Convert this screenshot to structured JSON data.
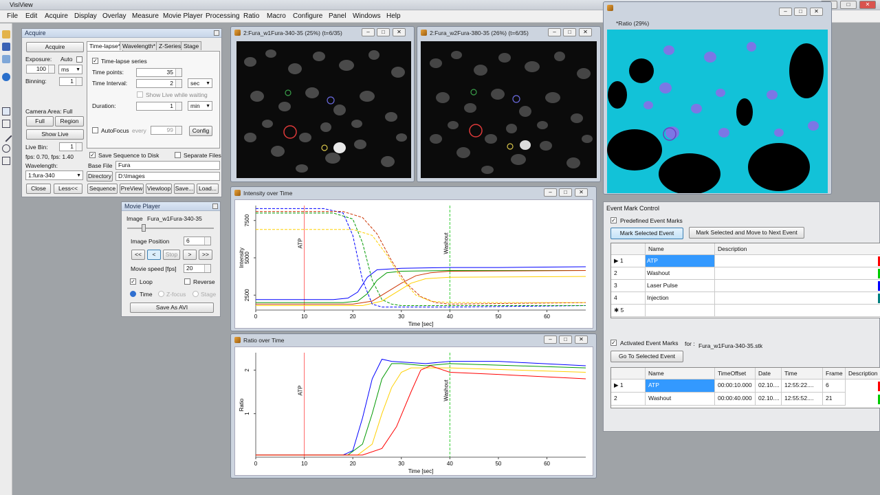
{
  "app": {
    "title": "VisiView"
  },
  "menu": [
    "File",
    "Edit",
    "Acquire",
    "Display",
    "Overlay",
    "Measure",
    "Movie Player",
    "Processing",
    "Ratio",
    "Macro",
    "Configure",
    "Panel",
    "Windows",
    "Help"
  ],
  "acquire": {
    "title": "Acquire",
    "acquire_btn": "Acquire",
    "exposure_label": "Exposure:",
    "auto_label": "Auto",
    "exposure_value": "100",
    "exposure_unit": "ms",
    "binning_label": "Binning:",
    "binning_value": "1",
    "camera_area_label": "Camera Area: Full",
    "full_btn": "Full",
    "region_btn": "Region",
    "show_live_btn": "Show Live",
    "live_bin_label": "Live Bin:",
    "live_bin_value": "1",
    "fps_text": "fps: 0.70, fps: 1.40",
    "wavelength_label": "Wavelength:",
    "wavelength_value": "1:fura-340",
    "close_btn": "Close",
    "less_btn": "Less<<",
    "tabs": [
      "Time-lapse*",
      "Wavelength*",
      "Z-Series",
      "Stage"
    ],
    "timelapse_series": "Time-lapse series",
    "time_points_label": "Time points:",
    "time_points_value": "35",
    "time_interval_label": "Time Interval:",
    "time_interval_value": "2",
    "time_interval_unit": "sec",
    "show_live_waiting": "Show Live while waiting",
    "duration_label": "Duration:",
    "duration_value": "1",
    "duration_unit": "min",
    "autofocus_label": "AutoFocus",
    "every_label": "every",
    "every_value": "99",
    "config_btn": "Config",
    "save_seq_label": "Save Sequence to Disk",
    "separate_files_label": "Separate Files",
    "base_file_label": "Base File",
    "base_file_value": "Fura",
    "directory_btn": "Directory",
    "directory_value": "D:\\Images",
    "bottom_buttons": [
      "Sequence",
      "PreView",
      "Viewloop",
      "Save...",
      "Load..."
    ]
  },
  "movie": {
    "title": "Movie Player",
    "image_label": "Image",
    "image_name": "Fura_w1Fura-340-35",
    "image_position_label": "Image Position",
    "image_position_value": "6",
    "nav": [
      "<<",
      "<",
      "Stop",
      ">",
      ">>"
    ],
    "speed_label": "Movie speed [fps]",
    "speed_value": "20",
    "loop_label": "Loop",
    "reverse_label": "Reverse",
    "modes": [
      "Time",
      "Z-focus",
      "Stage"
    ],
    "save_avi_btn": "Save As AVI"
  },
  "img_windows": [
    {
      "title": "2:Fura_w1Fura-340-35 (25%) (t=6/35)"
    },
    {
      "title": "2:Fura_w2Fura-380-35 (26%) (t=6/35)"
    },
    {
      "title": "*Ratio (29%)"
    }
  ],
  "intensity": {
    "title": "Intensity over Time",
    "chart_data": {
      "type": "line",
      "title": "",
      "xlabel": "Time [sec]",
      "ylabel": "Intensity",
      "xlim": [
        0,
        68
      ],
      "ylim": [
        1500,
        8500
      ],
      "x_ticks": [
        0,
        10,
        20,
        30,
        40,
        50,
        60
      ],
      "y_ticks": [
        2500,
        5000,
        7500
      ],
      "markers": [
        {
          "x": 10,
          "label": "ATP",
          "color": "#ff6666"
        },
        {
          "x": 40,
          "label": "Washout",
          "color": "#33cc33"
        }
      ],
      "series": [
        {
          "color": "#0000ff",
          "style": "solid",
          "x": [
            0,
            16,
            19,
            21,
            23,
            25,
            30,
            40,
            50,
            68
          ],
          "y": [
            2200,
            2200,
            2300,
            2700,
            3700,
            4200,
            4300,
            4350,
            4350,
            4400
          ]
        },
        {
          "color": "#009900",
          "style": "solid",
          "x": [
            0,
            18,
            21,
            23,
            25,
            27,
            30,
            40,
            68
          ],
          "y": [
            2000,
            2000,
            2100,
            2600,
            3500,
            4000,
            4100,
            4150,
            4150
          ]
        },
        {
          "color": "#cc3300",
          "style": "solid",
          "x": [
            0,
            20,
            24,
            27,
            30,
            33,
            36,
            40,
            68
          ],
          "y": [
            1900,
            1900,
            2100,
            2700,
            3300,
            3800,
            4000,
            4100,
            4150
          ]
        },
        {
          "color": "#ffd000",
          "style": "solid",
          "x": [
            0,
            22,
            26,
            29,
            32,
            35,
            40,
            68
          ],
          "y": [
            1800,
            1800,
            2100,
            2700,
            3300,
            3600,
            3700,
            3750
          ]
        },
        {
          "color": "#0000ff",
          "style": "dashed",
          "x": [
            0,
            14,
            18,
            20,
            22,
            24,
            26,
            30,
            40,
            68
          ],
          "y": [
            8300,
            8300,
            8000,
            6500,
            3500,
            1900,
            1700,
            1700,
            1700,
            1800
          ]
        },
        {
          "color": "#009900",
          "style": "dashed",
          "x": [
            0,
            16,
            20,
            22,
            24,
            26,
            28,
            30,
            40,
            68
          ],
          "y": [
            8000,
            8000,
            7600,
            6000,
            3500,
            2200,
            1900,
            1800,
            1800,
            1800
          ]
        },
        {
          "color": "#cc3300",
          "style": "dashed",
          "x": [
            0,
            18,
            22,
            25,
            28,
            31,
            34,
            37,
            40,
            68
          ],
          "y": [
            8100,
            8100,
            7700,
            6600,
            4800,
            3300,
            2400,
            2000,
            1900,
            2000
          ]
        },
        {
          "color": "#ffd000",
          "style": "dashed",
          "x": [
            0,
            20,
            24,
            27,
            30,
            33,
            36,
            40,
            68
          ],
          "y": [
            6900,
            6900,
            6500,
            5200,
            3600,
            2500,
            2100,
            2000,
            2000
          ]
        }
      ]
    }
  },
  "ratio_plot": {
    "title": "Ratio over Time",
    "chart_data": {
      "type": "line",
      "title": "",
      "xlabel": "Time [sec]",
      "ylabel": "Ratio",
      "xlim": [
        0,
        68
      ],
      "ylim": [
        0,
        2.4
      ],
      "x_ticks": [
        0,
        10,
        20,
        30,
        40,
        50,
        60
      ],
      "y_ticks": [
        1,
        2
      ],
      "markers": [
        {
          "x": 10,
          "label": "ATP",
          "color": "#ff6666"
        },
        {
          "x": 40,
          "label": "Washout",
          "color": "#33cc33"
        }
      ],
      "series": [
        {
          "color": "#0000ff",
          "style": "solid",
          "x": [
            0,
            18,
            20,
            22,
            24,
            26,
            28,
            35,
            40,
            50,
            68
          ],
          "y": [
            0.05,
            0.05,
            0.15,
            0.9,
            1.8,
            2.25,
            2.2,
            2.15,
            2.2,
            2.2,
            2.1
          ]
        },
        {
          "color": "#009900",
          "style": "solid",
          "x": [
            0,
            19,
            22,
            24,
            26,
            28,
            30,
            35,
            40,
            68
          ],
          "y": [
            0.05,
            0.05,
            0.3,
            1.0,
            1.8,
            2.15,
            2.15,
            2.1,
            2.15,
            2.05
          ]
        },
        {
          "color": "#ffd000",
          "style": "solid",
          "x": [
            0,
            21,
            24,
            26,
            28,
            30,
            32,
            40,
            68
          ],
          "y": [
            0.05,
            0.05,
            0.3,
            1.0,
            1.6,
            1.95,
            2.05,
            2.05,
            1.95
          ]
        },
        {
          "color": "#ff0000",
          "style": "solid",
          "x": [
            0,
            22,
            26,
            29,
            32,
            34,
            36,
            40,
            50,
            68
          ],
          "y": [
            0.05,
            0.05,
            0.2,
            0.7,
            1.5,
            2.0,
            2.1,
            1.95,
            1.9,
            1.8
          ]
        }
      ]
    }
  },
  "event_mark": {
    "title": "Event Mark Control",
    "predefined_label": "Predefined Event Marks",
    "mark_selected_btn": "Mark Selected Event",
    "mark_move_btn": "Mark Selected and Move to Next Event",
    "columns": [
      "Name",
      "Description"
    ],
    "rows": [
      {
        "num": "1",
        "name": "ATP",
        "color": "#ff0000"
      },
      {
        "num": "2",
        "name": "Washout",
        "color": "#00cc00"
      },
      {
        "num": "3",
        "name": "Laser Pulse",
        "color": "#0000ff"
      },
      {
        "num": "4",
        "name": "Injection",
        "color": "#008080"
      },
      {
        "num": "5",
        "name": "",
        "color": ""
      }
    ],
    "activated_label": "Activated Event Marks",
    "for_label": "for :",
    "for_file": "Fura_w1Fura-340-35.stk",
    "goto_btn": "Go To Selected Event",
    "act_columns": [
      "Name",
      "TimeOffset",
      "Date",
      "Time",
      "Frame",
      "Description"
    ],
    "act_rows": [
      {
        "num": "1",
        "name": "ATP",
        "offset": "00:00:10.000",
        "date": "02.10....",
        "time": "12:55:22....",
        "frame": "6",
        "color": "#ff0000"
      },
      {
        "num": "2",
        "name": "Washout",
        "offset": "00:00:40.000",
        "date": "02.10....",
        "time": "12:55:52....",
        "frame": "21",
        "color": "#00cc00"
      }
    ]
  }
}
